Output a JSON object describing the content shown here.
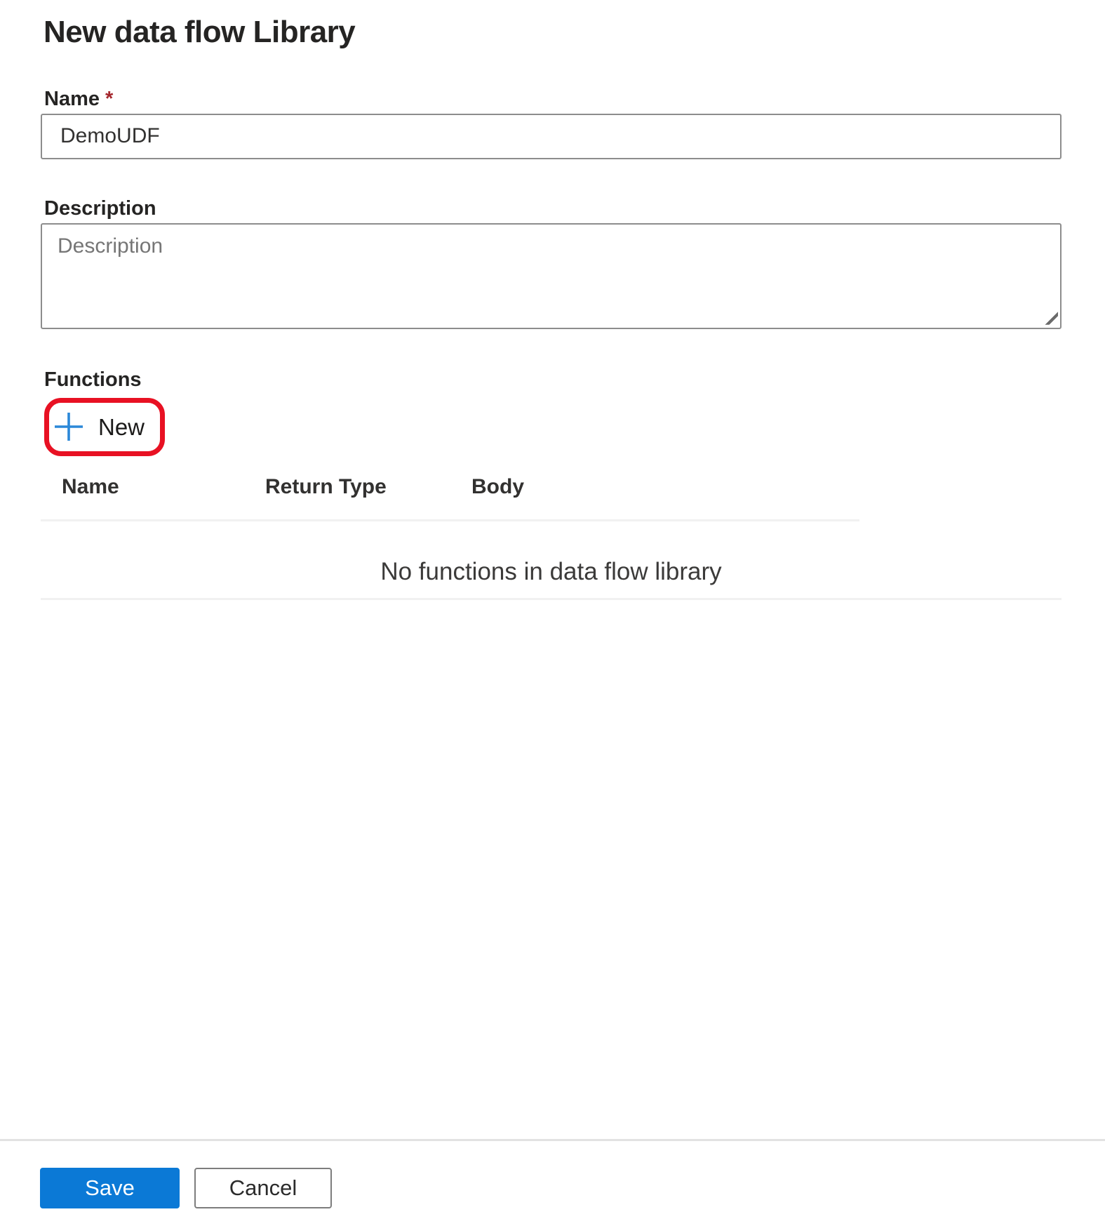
{
  "page": {
    "title": "New data flow Library"
  },
  "form": {
    "name_field": {
      "label": "Name",
      "required_marker": "*",
      "value": "DemoUDF"
    },
    "description_field": {
      "label": "Description",
      "placeholder": "Description"
    },
    "functions": {
      "label": "Functions",
      "new_button_label": "New",
      "table": {
        "columns": [
          "Name",
          "Return Type",
          "Body"
        ],
        "rows": [],
        "empty_message": "No functions in data flow library"
      }
    }
  },
  "footer": {
    "save_label": "Save",
    "cancel_label": "Cancel"
  },
  "colors": {
    "accent_blue": "#0b79d6",
    "plus_icon_blue": "#2b88d8",
    "annotation_red": "#e81123",
    "required_red": "#a4262c"
  }
}
